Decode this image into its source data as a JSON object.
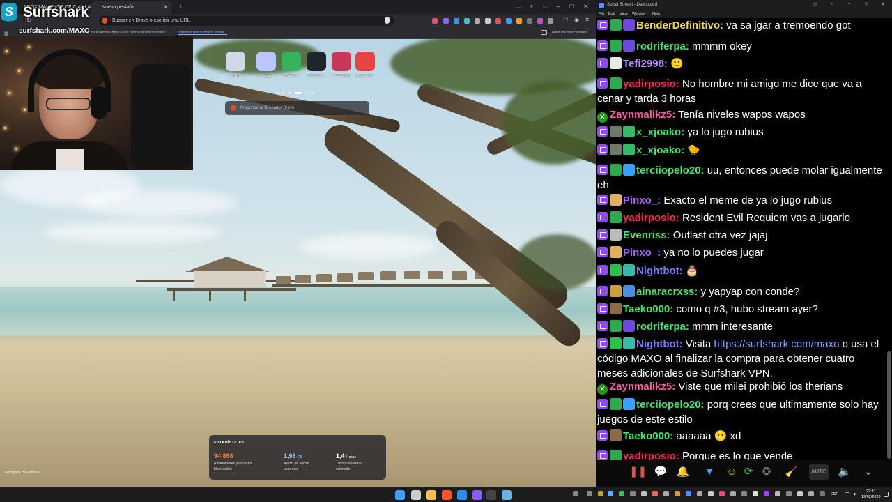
{
  "browser": {
    "tabs": [
      {
        "label": "PRÓXIMAMENTE OFICIAL LAUNCH TR..."
      },
      {
        "label": "Nueva pestaña"
      }
    ],
    "url_placeholder": "Buscar en Brave o escribir una URL",
    "bookmarks_bar": {
      "hint": "Para acceder de forma rápida, coloca los marcadores aquí en la barra de marcadores",
      "import_link": "Importar marcadores ahora...",
      "all_bookmarks": "Todos los marcadores"
    },
    "top_sites": [
      {
        "label": "SC DPS",
        "color": "#cfd8e6"
      },
      {
        "label": "Boggly",
        "color": "#b9c6ff"
      },
      {
        "label": "Waker SC",
        "color": "#38b25a"
      },
      {
        "label": "steamdyle...",
        "color": "#20252c"
      },
      {
        "label": "Cobblemon",
        "color": "#c6395a"
      },
      {
        "label": "EggBlaster",
        "color": "#e64545"
      }
    ],
    "search_placeholder": "Preguntar al Buscador Brave",
    "stats": {
      "title": "ESTADÍSTICAS",
      "items": [
        {
          "value": "94.868",
          "unit": "",
          "label": "Rastreadores y anuncios bloqueados",
          "color": "#ff7a45"
        },
        {
          "value": "1,96",
          "unit": "GB",
          "label": "Ancho de banda ahorrado",
          "color": "#a8b8ff"
        },
        {
          "value": "1,4",
          "unit": "Horas",
          "label": "Tiempo ahorrado estimado",
          "color": "#ffffff"
        }
      ]
    },
    "photo_credit": "Fotografía de Ramir KC"
  },
  "overlay": {
    "brand": "Surfshark",
    "brand_logo": "S",
    "url": "surfshark.com/MAXO"
  },
  "chat": {
    "window_title": "Social Stream - Dashboard",
    "menu": [
      "File",
      "Edit",
      "View",
      "Window",
      "Help"
    ],
    "messages": [
      {
        "platform": "twitch",
        "badges": [
          "bot-green",
          "bot-purple"
        ],
        "nick": "BenderDefinitivo:",
        "nick_color": "#f2d95c",
        "text": " va sa jgar a tremoendo got"
      },
      {
        "platform": "twitch",
        "badges": [
          "bot-green",
          "bot-purple"
        ],
        "nick": "rodriferpa:",
        "nick_color": "#3fe66a",
        "text": " mmmm okey"
      },
      {
        "platform": "twitch",
        "badges": [
          "skull"
        ],
        "nick": "Tefi2998:",
        "nick_color": "#b98dff",
        "text": " 🙂"
      },
      {
        "platform": "twitch",
        "badges": [
          "bot-green"
        ],
        "nick": "yadirposio:",
        "nick_color": "#ff2d55",
        "text": " No hombre mi amigo me dice que va a cenar y tarda 3 horas"
      },
      {
        "platform": "youtube",
        "badges": [],
        "nick": "Zaynmalikz5:",
        "nick_color": "#ff5aa8",
        "text": " Tenía niveles wapos wapos"
      },
      {
        "platform": "twitch",
        "badges": [
          "sword",
          "green-robot"
        ],
        "nick": "x_xjoako:",
        "nick_color": "#3fe66a",
        "text": " ya lo jugo rubius"
      },
      {
        "platform": "twitch",
        "badges": [
          "sword",
          "green-robot"
        ],
        "nick": "x_xjoako:",
        "nick_color": "#3fe66a",
        "text": " 🐤"
      },
      {
        "platform": "twitch",
        "badges": [
          "bot-green",
          "crown"
        ],
        "nick": "terciiopelo20:",
        "nick_color": "#3fe66a",
        "text": " uu, entonces puede molar igualmente eh"
      },
      {
        "platform": "twitch",
        "badges": [
          "pray"
        ],
        "nick": "Pinxo_:",
        "nick_color": "#a862ff",
        "text": " Exacto el meme de ya lo jugo rubius"
      },
      {
        "platform": "twitch",
        "badges": [
          "bot-green"
        ],
        "nick": "yadirposio:",
        "nick_color": "#ff2d55",
        "text": " Resident Evil Requiem vas a jugarlo"
      },
      {
        "platform": "twitch",
        "badges": [
          "dice"
        ],
        "nick": "Evenriss:",
        "nick_color": "#3fe66a",
        "text": " Outlast otra vez jajaj"
      },
      {
        "platform": "twitch",
        "badges": [
          "pray"
        ],
        "nick": "Pinxo_:",
        "nick_color": "#a862ff",
        "text": " ya no lo puedes jugar"
      },
      {
        "platform": "twitch",
        "badges": [
          "wrench",
          "robot"
        ],
        "nick": "Nightbot:",
        "nick_color": "#7b7bff",
        "text": " 🎂"
      },
      {
        "platform": "twitch",
        "badges": [
          "coins",
          "gift"
        ],
        "nick": "ainaracrxss:",
        "nick_color": "#3fe66a",
        "text": " y yapyap con conde?"
      },
      {
        "platform": "twitch",
        "badges": [
          "pickaxe"
        ],
        "nick": "Taeko000:",
        "nick_color": "#3fe66a",
        "text": " como q #3, hubo stream ayer?"
      },
      {
        "platform": "twitch",
        "badges": [
          "bot-green",
          "bot-purple"
        ],
        "nick": "rodriferpa:",
        "nick_color": "#3fe66a",
        "text": " mmm interesante"
      },
      {
        "platform": "twitch",
        "badges": [
          "wrench",
          "robot"
        ],
        "nick": "Nightbot:",
        "nick_color": "#7b7bff",
        "text": " Visita ",
        "link": "https://surfshark.com/maxo",
        "text2": " o usa el código MAXO al finalizar la compra para obtener cuatro meses adicionales de Surfshark VPN."
      },
      {
        "platform": "youtube",
        "badges": [],
        "nick": "Zaynmalikz5:",
        "nick_color": "#ff5aa8",
        "text": " Viste que milei prohibió los therians"
      },
      {
        "platform": "twitch",
        "badges": [
          "bot-green",
          "crown"
        ],
        "nick": "terciiopelo20:",
        "nick_color": "#3fe66a",
        "text": " porq crees que ultimamente solo hay juegos de este estilo"
      },
      {
        "platform": "twitch",
        "badges": [
          "pickaxe"
        ],
        "nick": "Taeko000:",
        "nick_color": "#3fe66a",
        "text": " aaaaaa  😶 xd"
      },
      {
        "platform": "twitch",
        "badges": [
          "bot-green"
        ],
        "nick": "yadirposio:",
        "nick_color": "#ff2d55",
        "text": " Porque es lo que vende"
      }
    ],
    "link_color": "#7aa0ff",
    "toolbar": [
      {
        "icon": "pause-icon",
        "glyph": "❚❚",
        "color": "#e05050"
      },
      {
        "icon": "chat-bubble-icon",
        "glyph": "💬",
        "color": "#4aa8ff"
      },
      {
        "icon": "bell-icon",
        "glyph": "🔔",
        "color": "#e0a030"
      },
      {
        "icon": "filter-icon",
        "glyph": "▼",
        "color": "#3aa0ff"
      },
      {
        "icon": "emoji-icon",
        "glyph": "☺",
        "color": "#e6c84a"
      },
      {
        "icon": "refresh-icon",
        "glyph": "⟳",
        "color": "#40c060"
      },
      {
        "icon": "star-icon",
        "glyph": "✪",
        "color": "#777777"
      },
      {
        "icon": "broom-icon",
        "glyph": "🧹",
        "color": "#e0b040"
      },
      {
        "icon": "auto-icon",
        "glyph": "AUTO",
        "color": "#888888"
      },
      {
        "icon": "volume-icon",
        "glyph": "🔈",
        "color": "#40c080"
      },
      {
        "icon": "collapse-icon",
        "glyph": "⌄",
        "color": "#aaaaaa"
      }
    ]
  },
  "taskbar": {
    "lang": "ESP",
    "time": "22:31",
    "date": "19/02/2026",
    "apps": [
      {
        "name": "start-icon",
        "color": "#3aa0ff"
      },
      {
        "name": "search-icon",
        "color": "#cccccc"
      },
      {
        "name": "explorer-icon",
        "color": "#f2c14e"
      },
      {
        "name": "brave-icon",
        "color": "#fb542b"
      },
      {
        "name": "app-blue-icon",
        "color": "#2d8cf0"
      },
      {
        "name": "app-purple-icon",
        "color": "#8a5cf6"
      },
      {
        "name": "app-dark-icon",
        "color": "#444444"
      },
      {
        "name": "steam-icon",
        "color": "#6ab0de"
      }
    ]
  }
}
